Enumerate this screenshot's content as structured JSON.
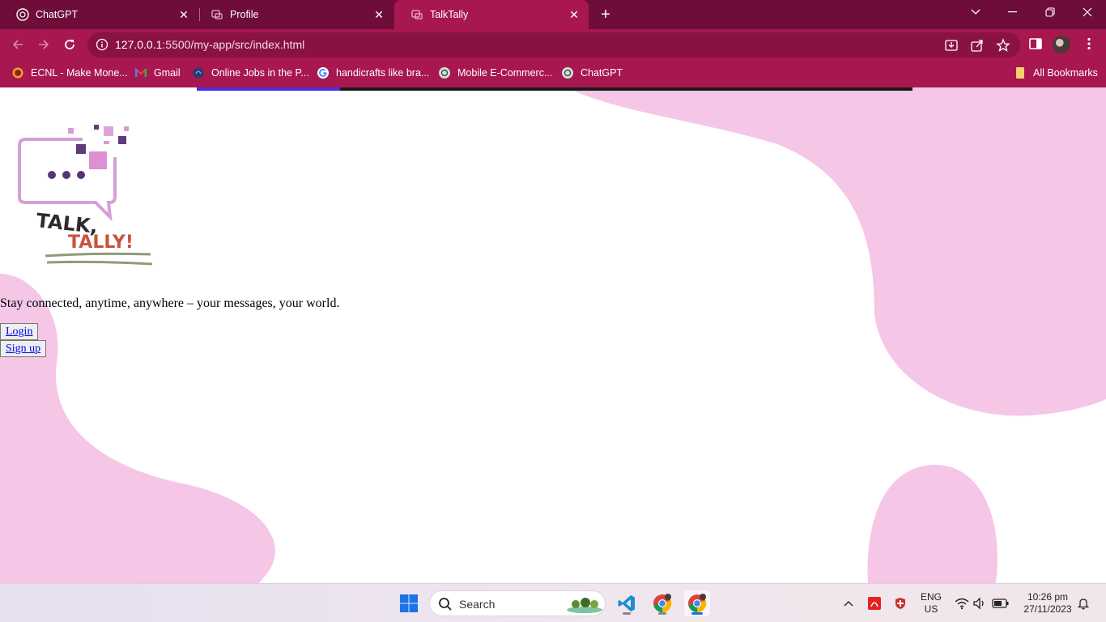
{
  "browser": {
    "tabs": [
      {
        "title": "ChatGPT",
        "icon": "chatgpt-icon",
        "active": false
      },
      {
        "title": "Profile",
        "icon": "page-icon",
        "active": false
      },
      {
        "title": "TalkTally",
        "icon": "page-icon",
        "active": true
      }
    ],
    "url": {
      "host": "127.0.0.1",
      "rest": ":5500/my-app/src/index.html"
    },
    "bookmarks": [
      {
        "label": "ECNL - Make Mone...",
        "icon": "ecnl-icon"
      },
      {
        "label": "Gmail",
        "icon": "gmail-icon"
      },
      {
        "label": "Online Jobs in the P...",
        "icon": "onlinejobs-icon"
      },
      {
        "label": "handicrafts like bra...",
        "icon": "google-icon"
      },
      {
        "label": "Mobile E-Commerc...",
        "icon": "chatgpt-icon"
      },
      {
        "label": "ChatGPT",
        "icon": "chatgpt-icon"
      }
    ],
    "all_bookmarks": "All Bookmarks",
    "colors": {
      "tabbar": "#6e0c3a",
      "toolbar": "#a8174f",
      "omnibox": "#8a1242"
    }
  },
  "page": {
    "logo": {
      "line1": "TALK,",
      "line2": "TALLY!"
    },
    "tagline": "Stay connected, anytime, anywhere – your messages, your world.",
    "login_label": "Login",
    "signup_label": "Sign up",
    "progress": 0.2,
    "colors": {
      "blob": "#f6c6e6",
      "progress_fill": "#4b2ee0",
      "progress_track": "#1a1a1a"
    }
  },
  "taskbar": {
    "search_placeholder": "Search",
    "apps": [
      "windows-start-icon",
      "vscode-icon",
      "chrome-icon",
      "chrome-icon"
    ],
    "lang": {
      "line1": "ENG",
      "line2": "US"
    },
    "clock": {
      "time": "10:26 pm",
      "date": "27/11/2023"
    }
  }
}
